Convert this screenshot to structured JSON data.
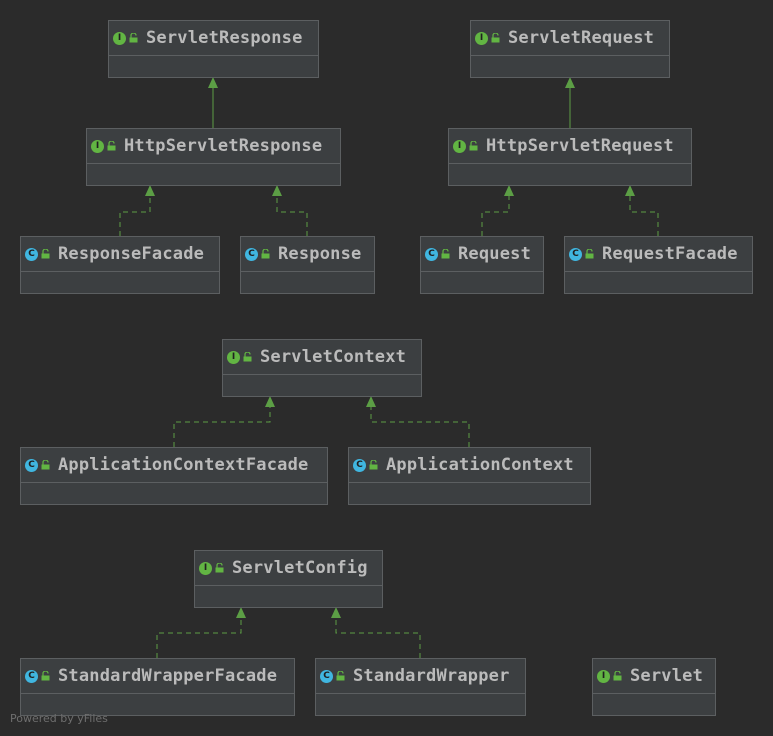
{
  "diagram": {
    "nodes": {
      "servlet_response": {
        "name": "ServletResponse",
        "kind": "interface",
        "kind_letter": "I"
      },
      "servlet_request": {
        "name": "ServletRequest",
        "kind": "interface",
        "kind_letter": "I"
      },
      "http_servlet_response": {
        "name": "HttpServletResponse",
        "kind": "interface",
        "kind_letter": "I"
      },
      "http_servlet_request": {
        "name": "HttpServletRequest",
        "kind": "interface",
        "kind_letter": "I"
      },
      "response_facade": {
        "name": "ResponseFacade",
        "kind": "class",
        "kind_letter": "C"
      },
      "response": {
        "name": "Response",
        "kind": "class",
        "kind_letter": "C"
      },
      "request": {
        "name": "Request",
        "kind": "class",
        "kind_letter": "C"
      },
      "request_facade": {
        "name": "RequestFacade",
        "kind": "class",
        "kind_letter": "C"
      },
      "servlet_context": {
        "name": "ServletContext",
        "kind": "interface",
        "kind_letter": "I"
      },
      "application_context_facade": {
        "name": "ApplicationContextFacade",
        "kind": "class",
        "kind_letter": "C"
      },
      "application_context": {
        "name": "ApplicationContext",
        "kind": "class",
        "kind_letter": "C"
      },
      "servlet_config": {
        "name": "ServletConfig",
        "kind": "interface",
        "kind_letter": "I"
      },
      "standard_wrapper_facade": {
        "name": "StandardWrapperFacade",
        "kind": "class",
        "kind_letter": "C"
      },
      "standard_wrapper": {
        "name": "StandardWrapper",
        "kind": "class",
        "kind_letter": "C"
      },
      "servlet": {
        "name": "Servlet",
        "kind": "interface",
        "kind_letter": "I"
      }
    },
    "edges": [
      {
        "from": "http_servlet_response",
        "to": "servlet_response",
        "type": "extends"
      },
      {
        "from": "http_servlet_request",
        "to": "servlet_request",
        "type": "extends"
      },
      {
        "from": "response_facade",
        "to": "http_servlet_response",
        "type": "implements"
      },
      {
        "from": "response",
        "to": "http_servlet_response",
        "type": "implements"
      },
      {
        "from": "request",
        "to": "http_servlet_request",
        "type": "implements"
      },
      {
        "from": "request_facade",
        "to": "http_servlet_request",
        "type": "implements"
      },
      {
        "from": "application_context_facade",
        "to": "servlet_context",
        "type": "implements"
      },
      {
        "from": "application_context",
        "to": "servlet_context",
        "type": "implements"
      },
      {
        "from": "standard_wrapper_facade",
        "to": "servlet_config",
        "type": "implements"
      },
      {
        "from": "standard_wrapper",
        "to": "servlet_config",
        "type": "implements"
      }
    ],
    "colors": {
      "background": "#2b2b2b",
      "node_fill": "#3c3f41",
      "node_border": "#5c5f61",
      "text": "#bbbbbb",
      "interface_badge": "#62b543",
      "class_badge": "#40b6e0",
      "edge": "#62a14a"
    }
  },
  "footer": "Powered by yFiles"
}
